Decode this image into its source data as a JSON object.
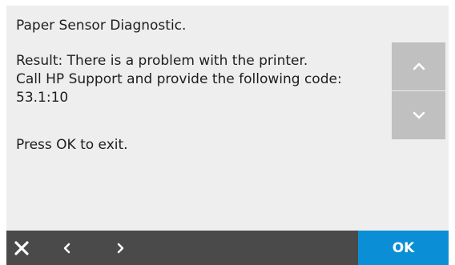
{
  "message": {
    "title": "Paper Sensor Diagnostic.",
    "result": "Result: There is a problem with the printer.\nCall HP Support and provide the following code:\n53.1:10",
    "instruction": "Press OK to exit."
  },
  "scroll": {
    "up_icon": "chevron-up-icon",
    "down_icon": "chevron-down-icon"
  },
  "bottom_bar": {
    "close_icon": "close-icon",
    "back_icon": "chevron-left-icon",
    "forward_icon": "chevron-right-icon",
    "ok_label": "OK"
  },
  "colors": {
    "background": "#eeeeee",
    "bottom_bar": "#4a4a4a",
    "ok_button": "#0a8fd6",
    "scroll_button": "#c0c0c0"
  }
}
